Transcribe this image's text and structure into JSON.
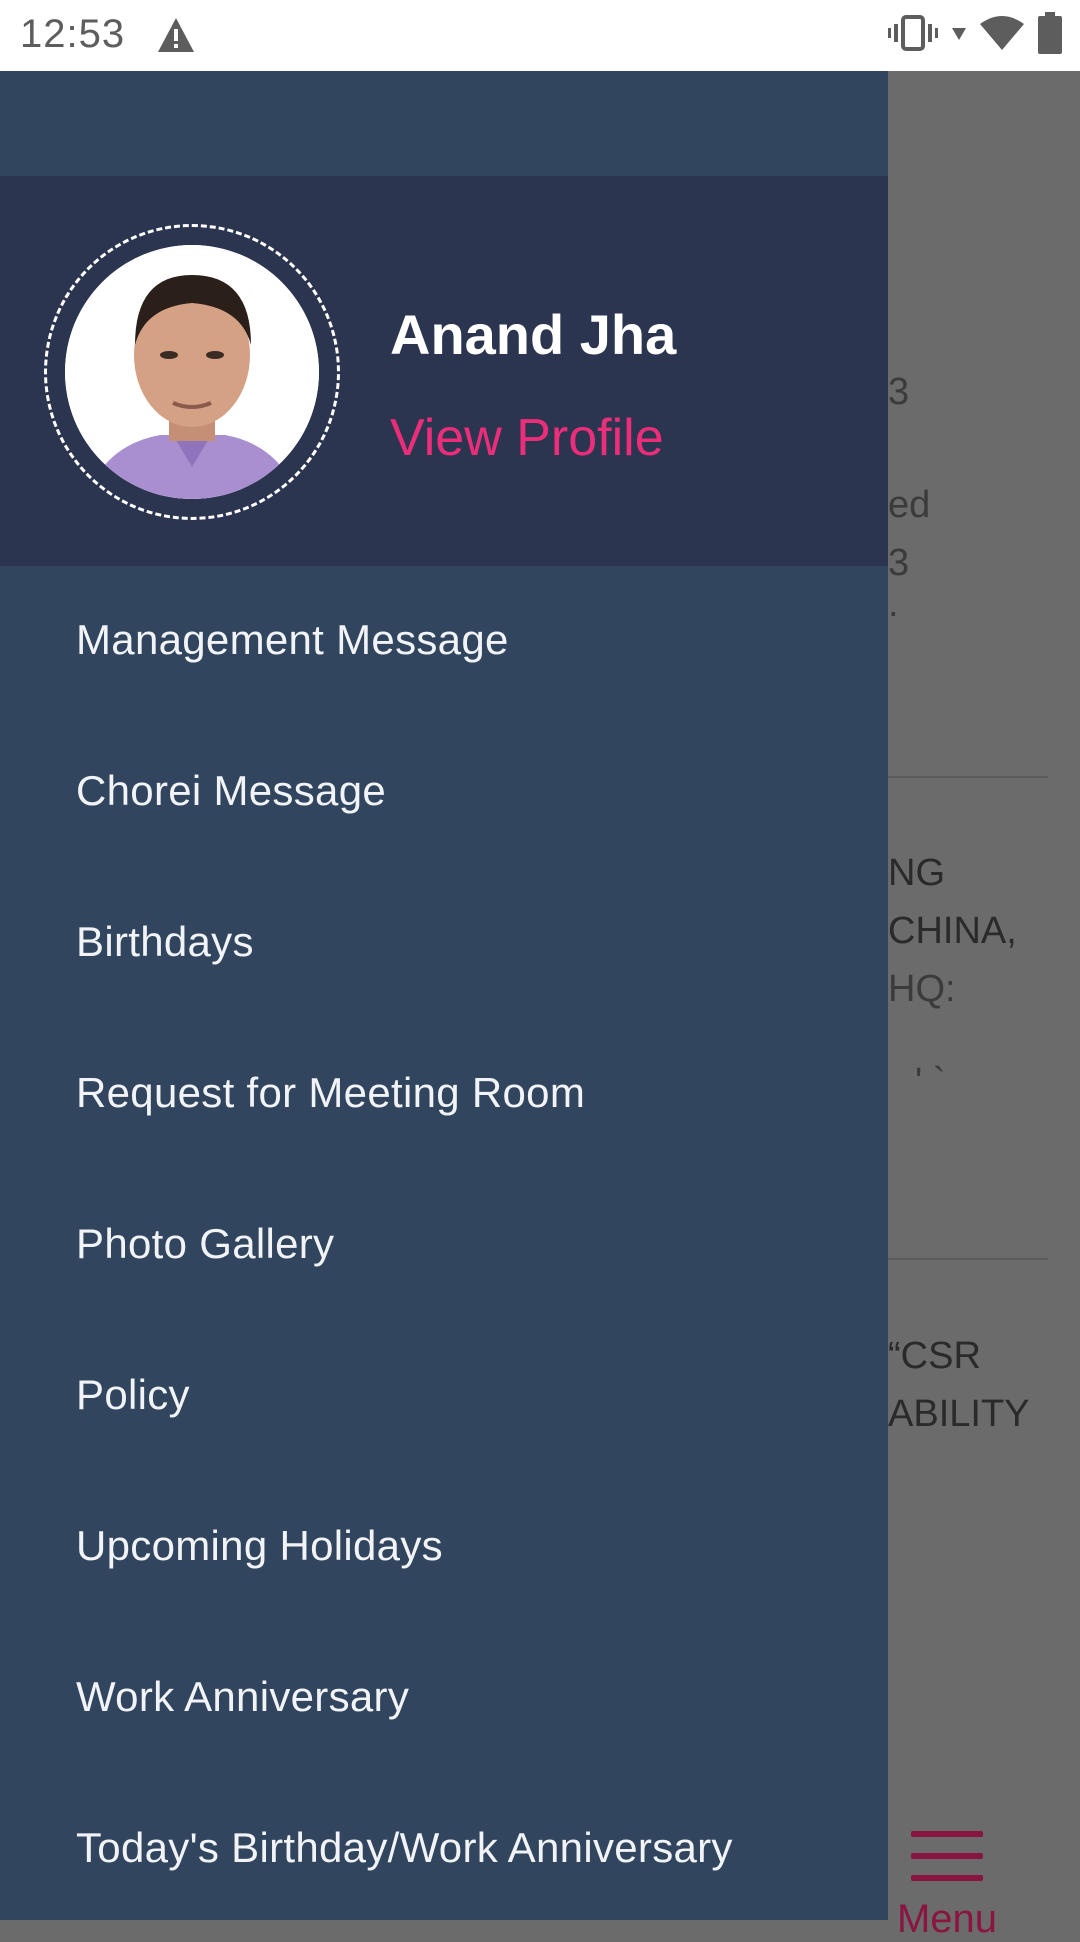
{
  "status_bar": {
    "time": "12:53",
    "icons": [
      "alert-icon",
      "vibrate-icon",
      "wifi-icon",
      "battery-icon"
    ]
  },
  "user": {
    "name": "Anand Jha",
    "view_profile_label": "View Profile"
  },
  "menu": {
    "items": [
      {
        "label": "Management Message"
      },
      {
        "label": "Chorei Message"
      },
      {
        "label": "Birthdays"
      },
      {
        "label": "Request for Meeting Room"
      },
      {
        "label": "Photo Gallery"
      },
      {
        "label": "Policy"
      },
      {
        "label": "Upcoming Holidays"
      },
      {
        "label": "Work Anniversary"
      },
      {
        "label": "Today's Birthday/Work Anniversary"
      }
    ]
  },
  "background": {
    "fragments": [
      "3",
      "ed",
      "3",
      ".",
      "NG",
      "CHINA,",
      "HQ:",
      "' `",
      "“CSR",
      "ABILITY"
    ],
    "bottom_nav_label": "Menu"
  },
  "colors": {
    "drawer_bg": "#31465e",
    "header_bg": "#2c354f",
    "accent_pink": "#ec2d7a",
    "menu_accent": "#8a1540"
  }
}
